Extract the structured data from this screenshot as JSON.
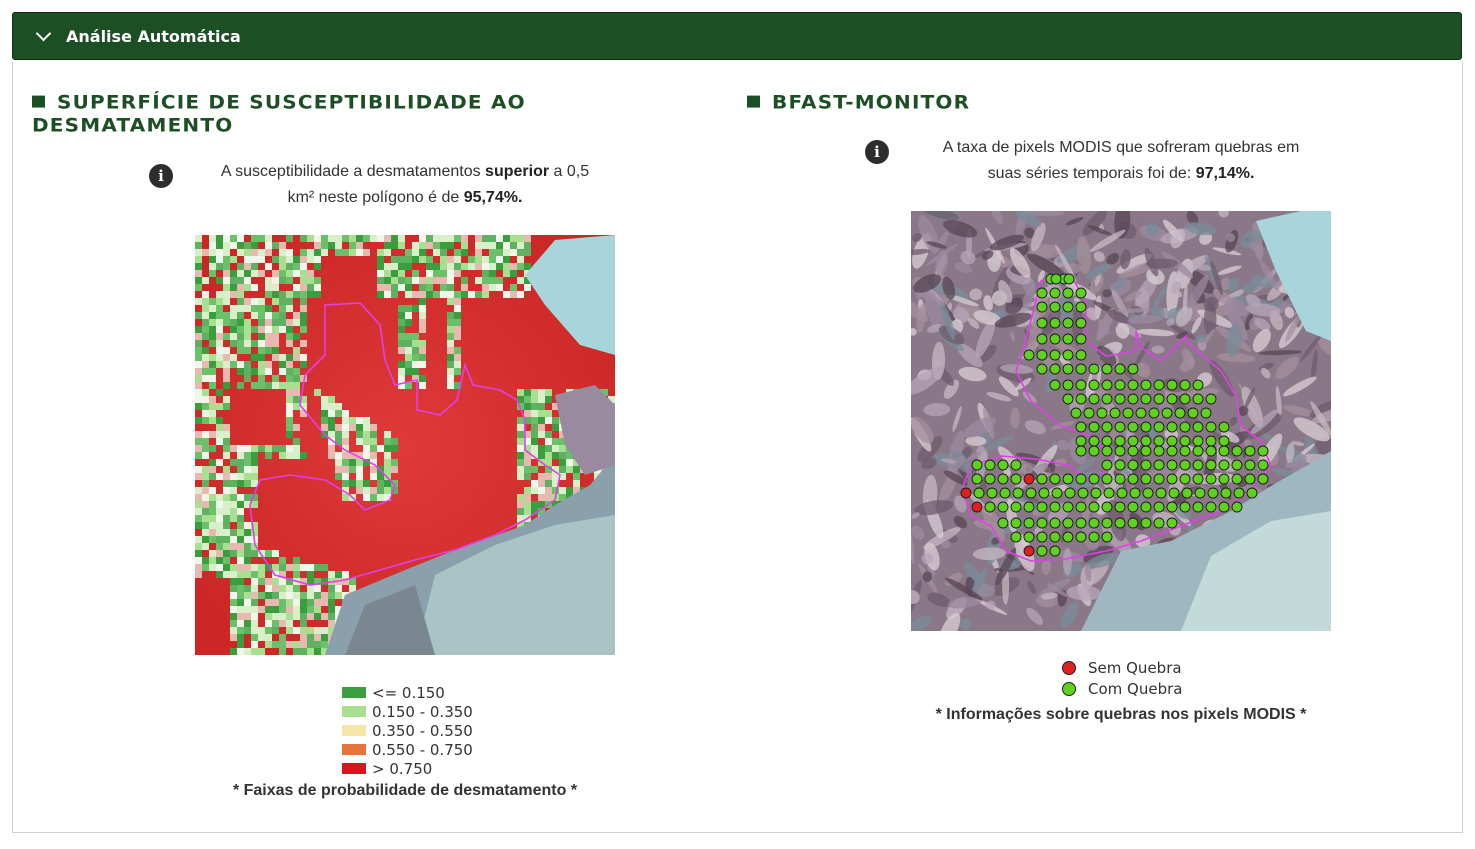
{
  "header": {
    "title": "Análise Automática"
  },
  "susceptibility": {
    "title_line1": "Superfície de Susceptibilidade ao",
    "title_line2": "Desmatamento",
    "info_part1": "A susceptibilidade a desmatamentos ",
    "info_bold1": "superior",
    "info_part2": " a 0,5",
    "info_part3": "km² neste polígono é de ",
    "info_value": "95,74%.",
    "legend": [
      {
        "label": "<= 0.150",
        "color": "#3a9e3f"
      },
      {
        "label": "0.150 - 0.350",
        "color": "#a9df91"
      },
      {
        "label": "0.350 - 0.550",
        "color": "#f7e7a6"
      },
      {
        "label": "0.550 - 0.750",
        "color": "#e8733a"
      },
      {
        "label": "> 0.750",
        "color": "#d3171c"
      }
    ],
    "caption": "* Faixas de probabilidade de desmatamento *"
  },
  "bfast": {
    "title": "BFAST-Monitor",
    "info_part1": "A taxa de pixels MODIS que sofreram quebras em",
    "info_part2": "suas séries temporais foi de: ",
    "info_value": "97,14%.",
    "legend": [
      {
        "label": "Sem Quebra",
        "color": "#e02020"
      },
      {
        "label": "Com Quebra",
        "color": "#5fd21f"
      }
    ],
    "caption": "* Informações sobre quebras nos pixels MODIS *"
  },
  "colors": {
    "accent": "#1d4f25",
    "polygon": "#e040e8"
  }
}
